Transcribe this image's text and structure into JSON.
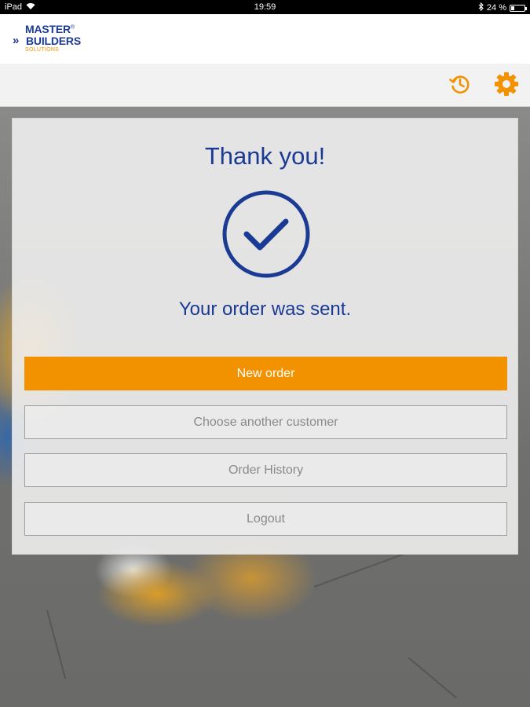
{
  "status_bar": {
    "device": "iPad",
    "time": "19:59",
    "battery": "24 %",
    "battery_level": 0.24
  },
  "header": {
    "logo_line1": "MASTER",
    "logo_reg": "®",
    "logo_chevrons": "»",
    "logo_line2": "BUILDERS",
    "logo_line3": "SOLUTIONS"
  },
  "toolbar": {
    "icons": [
      "history-icon",
      "settings-gear-icon"
    ],
    "accent_color": "#f39200"
  },
  "card": {
    "title": "Thank you!",
    "check_icon": "check-circle-icon",
    "message": "Your order was sent.",
    "buttons": {
      "new_order": "New order",
      "choose_customer": "Choose another customer",
      "order_history": "Order History",
      "logout": "Logout"
    }
  },
  "colors": {
    "brand_blue": "#1b3a94",
    "accent_orange": "#f39200"
  }
}
